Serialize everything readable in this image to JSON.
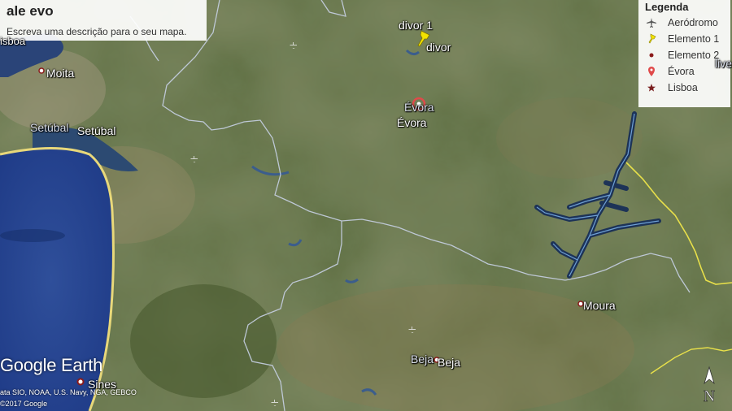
{
  "panel": {
    "title": "ale evo",
    "description": "Escreva uma descrição para o seu mapa."
  },
  "legend": {
    "title": "Legenda",
    "items": [
      {
        "label": "Aeródromo",
        "icon": "airplane-icon",
        "color": "#555555"
      },
      {
        "label": "Elemento 1",
        "icon": "yellow-pushpin-icon",
        "color": "#f2e200"
      },
      {
        "label": "Elemento 2",
        "icon": "dot-icon",
        "color": "#8b1a1a"
      },
      {
        "label": "Évora",
        "icon": "red-pin-icon",
        "color": "#e04a4a"
      },
      {
        "label": "Lisboa",
        "icon": "star-icon",
        "color": "#7a1f1f"
      }
    ]
  },
  "places": {
    "divor1": "divor 1",
    "divor": "divor",
    "evora": "Évora",
    "evora2": "Évora",
    "moita": "Moita",
    "setubal1": "Setúbal",
    "setubal2": "Setúbal",
    "lisboa": "isboa",
    "moura": "Moura",
    "beja1": "Beja",
    "beja2": "Beja",
    "sines": "Sines",
    "olive": "live"
  },
  "attribution": {
    "logo": "Google Earth",
    "data": "ata SIO, NOAA, U.S. Navy, NGA, GEBCO",
    "copyright": "©2017 Google"
  },
  "compass": "N"
}
